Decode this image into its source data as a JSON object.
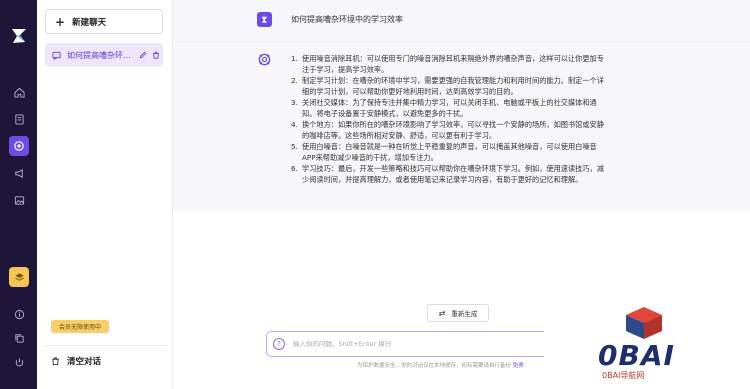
{
  "rail": {
    "icons": [
      "logo-icon",
      "home-icon",
      "document-icon",
      "chat-icon",
      "megaphone-icon",
      "image-icon",
      "vip-icon",
      "info-icon",
      "copy-icon",
      "logout-icon"
    ]
  },
  "sidebar": {
    "new_chat_label": "新建聊天",
    "conversations": [
      {
        "title": "如何提高嘈杂环..."
      }
    ],
    "vip_badge": "会员无限使用中",
    "clear_label": "清空对话"
  },
  "chat": {
    "question": "如何提高嘈杂环境中的学习效率",
    "answer": [
      {
        "num": "1.",
        "lines": [
          "使用噪音消除耳机：可以使用专门的噪音消除耳机来隔绝外界的嘈杂声音，这样可以让你更加专",
          "注于学习，提高学习效率。"
        ]
      },
      {
        "num": "2.",
        "lines": [
          "制定学习计划：在嘈杂的环境中学习，需要更强的自我管理能力和利用时间的能力。制定一个详",
          "细的学习计划，可以帮助你更好地利用时间，达到高效学习的目的。"
        ]
      },
      {
        "num": "3.",
        "lines": [
          "关闭社交媒体：为了保持专注并集中精力学习，可以关闭手机、电脑或平板上的社交媒体和通",
          "知。将电子设备置于安静模式，以避免更多的干扰。"
        ]
      },
      {
        "num": "4.",
        "lines": [
          "换个地方：如果你所在的嘈杂环境影响了学习效率，可以寻找一个安静的场所，如图书馆或安静",
          "的咖啡店等。这些场所相对安静、舒适，可以更有利于学习。"
        ]
      },
      {
        "num": "5.",
        "lines": [
          "使用白噪音：白噪音就是一种在听觉上平稳重复的声音，可以掩盖其他噪音，可以使用白噪音",
          "APP来帮助减少噪音的干扰，增加专注力。"
        ]
      },
      {
        "num": "6.",
        "lines": [
          "学习技巧：最后，开发一些策略和技巧可以帮助你在嘈杂环境下学习。例如，使用速读技巧，减",
          "少阅读时间，并提高理解力，或者使用笔记来记录学习内容，有助于更好的记忆和理解。"
        ]
      }
    ],
    "regenerate_label": "重新生成",
    "input_placeholder": "输入你的问题，Shift+Enter 换行",
    "disclaimer": "为保护数据安全，你的对话仅在本地缓存，如有需要请自行备份 ",
    "disclaimer_link": "免责"
  },
  "watermark": {
    "brand": "0BAI",
    "sub": "0BAI导航网"
  },
  "colors": {
    "rail_bg": "#1e1638",
    "accent": "#6b4ee6",
    "vip": "#f3c657"
  }
}
